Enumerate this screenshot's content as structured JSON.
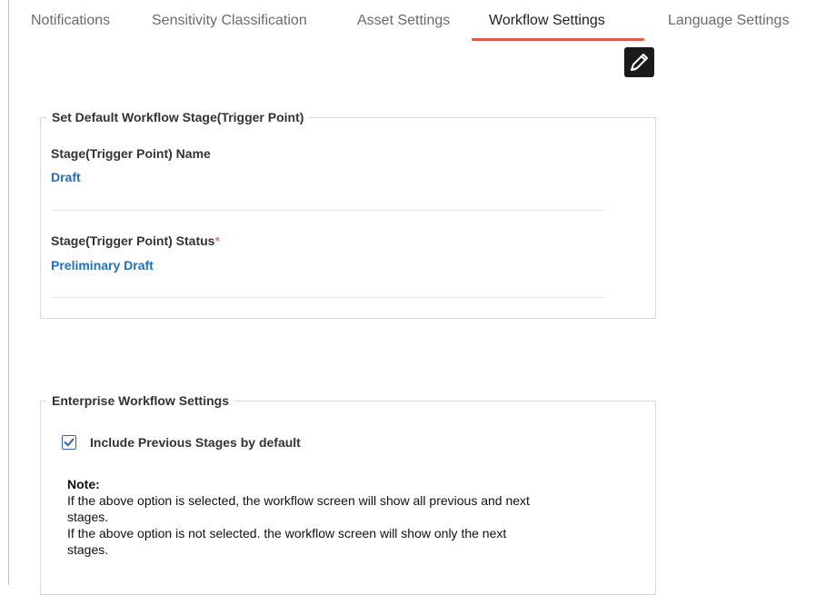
{
  "tabs": [
    {
      "label": "Notifications",
      "active": false
    },
    {
      "label": "Sensitivity Classification",
      "active": false
    },
    {
      "label": "Asset Settings",
      "active": false
    },
    {
      "label": "Workflow Settings",
      "active": true
    },
    {
      "label": "Language Settings",
      "active": false
    }
  ],
  "toolbar": {
    "edit_icon": "pencil-edit-icon"
  },
  "default_stage": {
    "legend": "Set Default Workflow Stage(Trigger Point)",
    "name_label": "Stage(Trigger Point) Name",
    "name_value": "Draft",
    "status_label": "Stage(Trigger Point) Status",
    "status_required": "*",
    "status_value": "Preliminary Draft"
  },
  "enterprise": {
    "legend": "Enterprise Workflow Settings",
    "include_previous_label": "Include Previous Stages by default",
    "include_previous_checked": true,
    "note_title": "Note:",
    "note_lines": [
      "If the above option is selected, the workflow screen will show all previous and next",
      "stages.",
      "If the above option is not selected. the workflow screen will show only the next",
      "stages."
    ]
  },
  "colors": {
    "accent": "#e2574c",
    "link": "#1f6fc5",
    "checkbox": "#2f63c2"
  }
}
